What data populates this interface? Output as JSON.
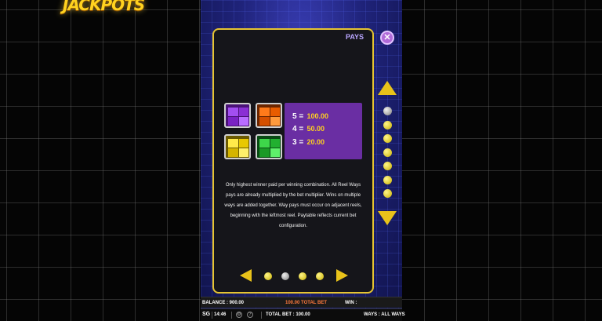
{
  "logo": {
    "text": "JACKPOTS"
  },
  "panel": {
    "title": "PAYS",
    "close_icon": "✕",
    "symbols": [
      "purple-block",
      "orange-block",
      "yellow-block",
      "green-block"
    ],
    "pays": [
      {
        "count": "5 =",
        "value": "100.00"
      },
      {
        "count": "4 =",
        "value": "50.00"
      },
      {
        "count": "3 =",
        "value": "20.00"
      }
    ],
    "description": "Only highest winner paid per winning combination. All Reel Ways pays are already multiplied by the bet multiplier. Wins on multiple ways are added together. Way pays must occur on adjacent reels, beginning with the leftmost reel. Paytable reflects current bet configuration.",
    "pagination": {
      "pages": 4,
      "active": 2
    }
  },
  "side_nav": {
    "dots": 7,
    "active": 1
  },
  "status_bar": {
    "balance": "BALANCE : 900.00",
    "total_bet_center": "100.00 TOTAL BET",
    "win": "WIN :",
    "brand": "SG",
    "time": "14:46",
    "total_bet": "TOTAL BET : 100.00",
    "ways": "WAYS : ALL WAYS"
  },
  "colors": {
    "accent_gold": "#e6c432",
    "pay_panel": "#6a2ea3",
    "game_blue": "#1f237a"
  }
}
